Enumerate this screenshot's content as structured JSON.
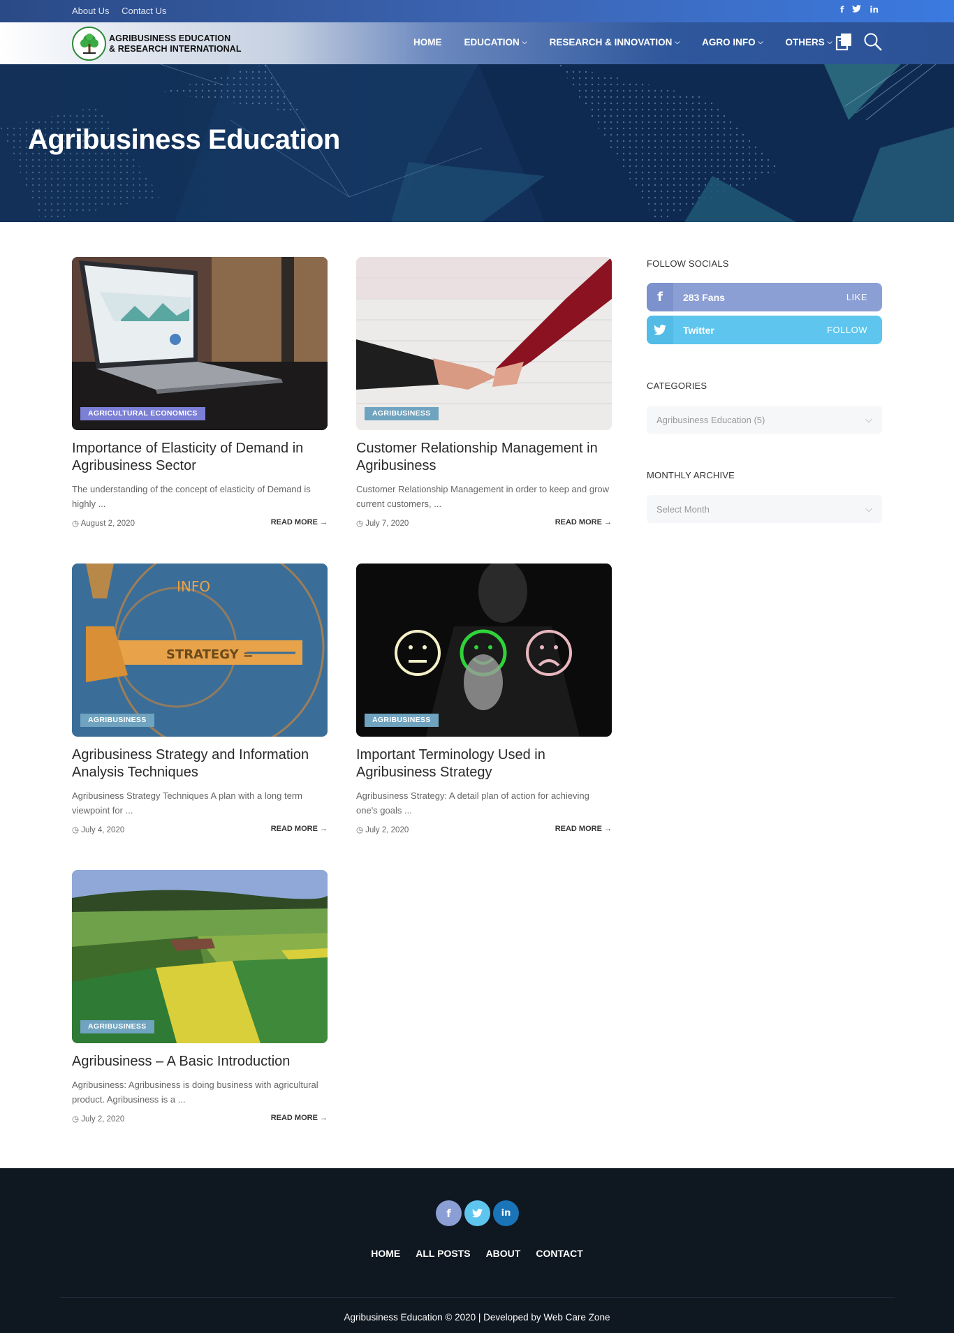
{
  "topbar": {
    "links": [
      "About Us",
      "Contact Us"
    ],
    "social_icons": [
      "facebook-icon",
      "twitter-icon",
      "linkedin-icon"
    ]
  },
  "header": {
    "logo_line1": "AGRIBUSINESS EDUCATION",
    "logo_line2": "& RESEARCH INTERNATIONAL",
    "nav": [
      {
        "label": "HOME",
        "has_dropdown": false
      },
      {
        "label": "EDUCATION",
        "has_dropdown": true
      },
      {
        "label": "RESEARCH & INNOVATION",
        "has_dropdown": true
      },
      {
        "label": "AGRO INFO",
        "has_dropdown": true
      },
      {
        "label": "OTHERS",
        "has_dropdown": true
      }
    ]
  },
  "hero": {
    "title": "Agribusiness Education"
  },
  "posts": [
    {
      "category": "AGRICULTURAL ECONOMICS",
      "title": "Importance of Elasticity of Demand in Agribusiness Sector",
      "excerpt": "The understanding of the concept of elasticity of Demand is highly ...",
      "date": "August 2, 2020",
      "read_more": "READ MORE"
    },
    {
      "category": "AGRIBUSINESS",
      "title": "Customer Relationship Management in Agribusiness",
      "excerpt": "Customer Relationship Management in order to keep and grow current customers, ...",
      "date": "July 7, 2020",
      "read_more": "READ MORE"
    },
    {
      "category": "AGRIBUSINESS",
      "title": "Agribusiness Strategy and Information Analysis Techniques",
      "excerpt": "Agribusiness Strategy Techniques A plan with a long term viewpoint for ...",
      "date": "July 4, 2020",
      "read_more": "READ MORE"
    },
    {
      "category": "AGRIBUSINESS",
      "title": "Important Terminology Used in Agribusiness Strategy",
      "excerpt": "Agribusiness Strategy: A detail plan of action for achieving one's goals ...",
      "date": "July 2, 2020",
      "read_more": "READ MORE"
    },
    {
      "category": "AGRIBUSINESS",
      "title": "Agribusiness – A Basic Introduction",
      "excerpt": "Agribusiness: Agribusiness is doing business with agricultural product. Agribusiness is a ...",
      "date": "July 2, 2020",
      "read_more": "READ MORE"
    }
  ],
  "sidebar": {
    "follow_heading": "FOLLOW SOCIALS",
    "facebook": {
      "label": "283 Fans",
      "action": "LIKE",
      "color": "#8b9fd4"
    },
    "twitter": {
      "label": "Twitter",
      "action": "FOLLOW",
      "color": "#5ec6ee"
    },
    "categories_heading": "CATEGORIES",
    "categories_selected": "Agribusiness Education  (5)",
    "archive_heading": "MONTHLY ARCHIVE",
    "archive_selected": "Select Month"
  },
  "footer": {
    "social_icons": [
      "facebook-icon",
      "twitter-icon",
      "linkedin-icon"
    ],
    "menu": [
      "HOME",
      "ALL POSTS",
      "ABOUT",
      "CONTACT"
    ],
    "copyright": "Agribusiness Education © 2020 | Developed by Web Care Zone"
  },
  "colors": {
    "category_badge_primary": "#7b7fd6",
    "category_badge": "#6fa3bf",
    "footer_bg": "#0f1720"
  }
}
